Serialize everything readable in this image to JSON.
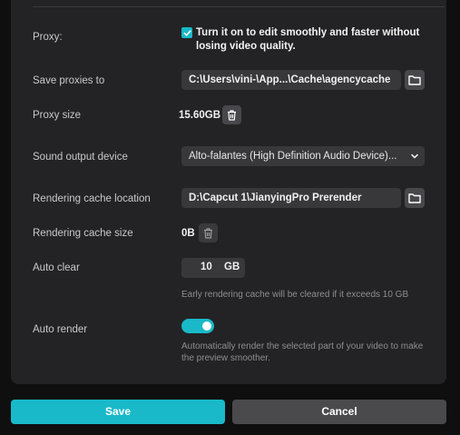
{
  "settings": {
    "proxy": {
      "label": "Proxy:",
      "checked": true,
      "description": "Turn it on to edit smoothly and faster without losing video quality."
    },
    "save_proxies": {
      "label": "Save proxies to",
      "value": "C:\\Users\\vini-\\App...\\Cache\\agencycache"
    },
    "proxy_size": {
      "label": "Proxy size",
      "value": "15.60GB"
    },
    "sound_output": {
      "label": "Sound output device",
      "value": "Alto-falantes (High Definition Audio Device)..."
    },
    "render_cache_location": {
      "label": "Rendering cache location",
      "value": "D:\\Capcut 1\\JianyingPro Prerender"
    },
    "render_cache_size": {
      "label": "Rendering cache size",
      "value": "0B"
    },
    "auto_clear": {
      "label": "Auto clear",
      "value": "10",
      "unit": "GB",
      "hint": "Early rendering cache will be cleared if it exceeds 10 GB"
    },
    "auto_render": {
      "label": "Auto render",
      "enabled": true,
      "hint": "Automatically render the selected part of your video to make the preview smoother."
    }
  },
  "footer": {
    "save_label": "Save",
    "cancel_label": "Cancel"
  },
  "colors": {
    "accent": "#19b9c9",
    "panel": "#232325",
    "background": "#0f0f10"
  },
  "icons": [
    "check-icon",
    "folder-icon",
    "trash-icon",
    "chevron-down-icon"
  ]
}
